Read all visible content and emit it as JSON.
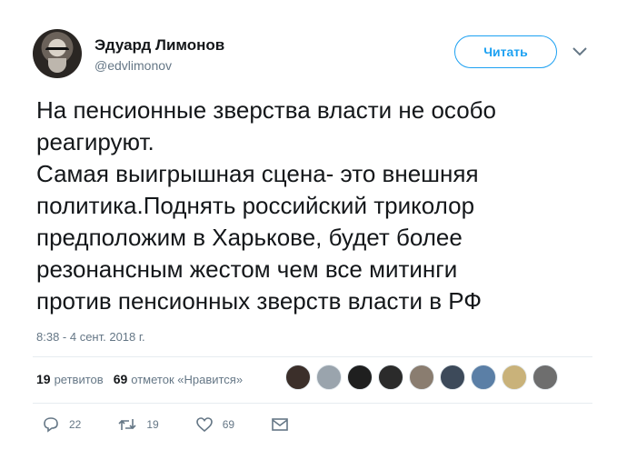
{
  "author": {
    "display_name": "Эдуард Лимонов",
    "handle": "@edvlimonov"
  },
  "follow_button": {
    "label": "Читать"
  },
  "tweet": {
    "lines": [
      "На пенсионные зверства власти не особо",
      "реагируют.",
      "Самая выигрышная сцена- это внешняя",
      "политика.Поднять российский триколор",
      "предположим в Харькове, будет более",
      "резонансным жестом чем все митинги",
      "против пенсионных зверств власти в РФ"
    ],
    "timestamp": "8:38 - 4 сент. 2018 г."
  },
  "stats": {
    "retweets_count": "19",
    "retweets_label": "ретвитов",
    "likes_count": "69",
    "likes_label": "отметок «Нравится»"
  },
  "likers": [
    {
      "name": "liker-avatar-1",
      "color": "#3b2f2a"
    },
    {
      "name": "liker-avatar-2",
      "color": "#9aa4ad"
    },
    {
      "name": "liker-avatar-3",
      "color": "#1f1f1f"
    },
    {
      "name": "liker-avatar-4",
      "color": "#2b2b2b"
    },
    {
      "name": "liker-avatar-5",
      "color": "#8a7d70"
    },
    {
      "name": "liker-avatar-6",
      "color": "#3d4a5a"
    },
    {
      "name": "liker-avatar-7",
      "color": "#5b7fa6"
    },
    {
      "name": "liker-avatar-8",
      "color": "#c9b27a"
    },
    {
      "name": "liker-avatar-9",
      "color": "#6e6e6e"
    }
  ],
  "actions": {
    "reply_count": "22",
    "retweet_count": "19",
    "like_count": "69"
  },
  "colors": {
    "accent": "#1da1f2",
    "muted": "#657786",
    "text": "#14171a"
  }
}
